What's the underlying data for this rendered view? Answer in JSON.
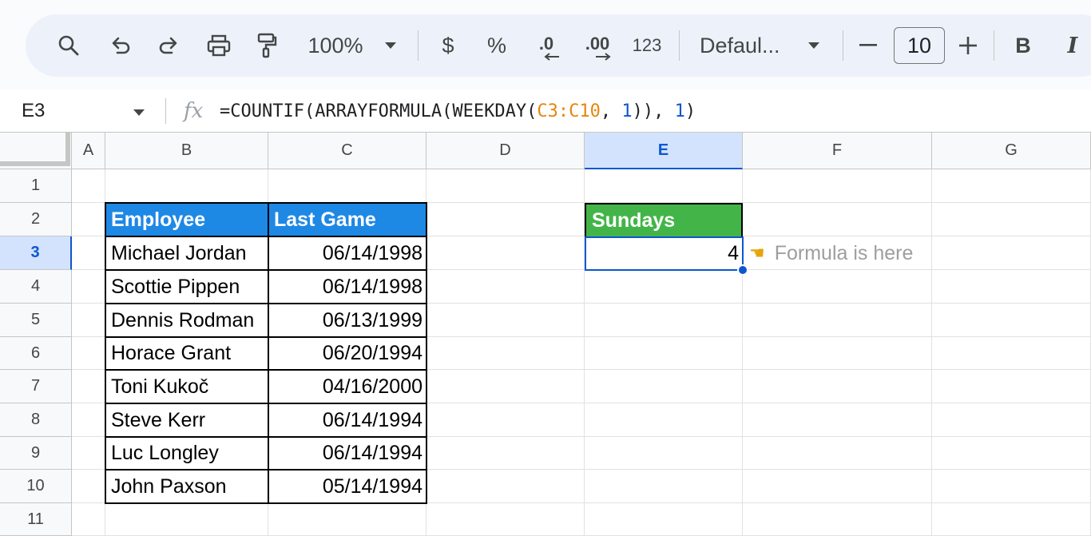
{
  "toolbar": {
    "zoom": "100%",
    "currency": "$",
    "percent": "%",
    "decrease_decimal": ".0",
    "increase_decimal": ".00",
    "number_format": "123",
    "font": "Defaul...",
    "font_size": "10",
    "bold": "B",
    "italic": "I"
  },
  "formula_bar": {
    "name_box": "E3",
    "fx": "fx",
    "formula_prefix": "=COUNTIF(ARRAYFORMULA(WEEKDAY(",
    "formula_range": "C3:C10",
    "formula_mid": ", ",
    "formula_arg1": "1",
    "formula_close": ")), ",
    "formula_arg2": "1",
    "formula_end": ")"
  },
  "columns": [
    "A",
    "B",
    "C",
    "D",
    "E",
    "F",
    "G"
  ],
  "rows": [
    "1",
    "2",
    "3",
    "4",
    "5",
    "6",
    "7",
    "8",
    "9",
    "10",
    "11"
  ],
  "table": {
    "headers": [
      "Employee",
      "Last Game"
    ],
    "header_color": "#1e88e5",
    "rows": [
      [
        "Michael Jordan",
        "06/14/1998"
      ],
      [
        "Scottie Pippen",
        "06/14/1998"
      ],
      [
        "Dennis Rodman",
        "06/13/1999"
      ],
      [
        "Horace Grant",
        "06/20/1994"
      ],
      [
        "Toni Kukoč",
        "04/16/2000"
      ],
      [
        "Steve Kerr",
        "06/14/1994"
      ],
      [
        "Luc Longley",
        "06/14/1994"
      ],
      [
        "John Paxson",
        "05/14/1994"
      ]
    ]
  },
  "result": {
    "header": "Sundays",
    "header_color": "#43b548",
    "value": "4",
    "note": "Formula is here",
    "note_icon": "pointing-hand-icon"
  },
  "colors": {
    "selection": "#0b57d0",
    "formula_range": "#e8850c",
    "formula_number": "#1155cc"
  }
}
